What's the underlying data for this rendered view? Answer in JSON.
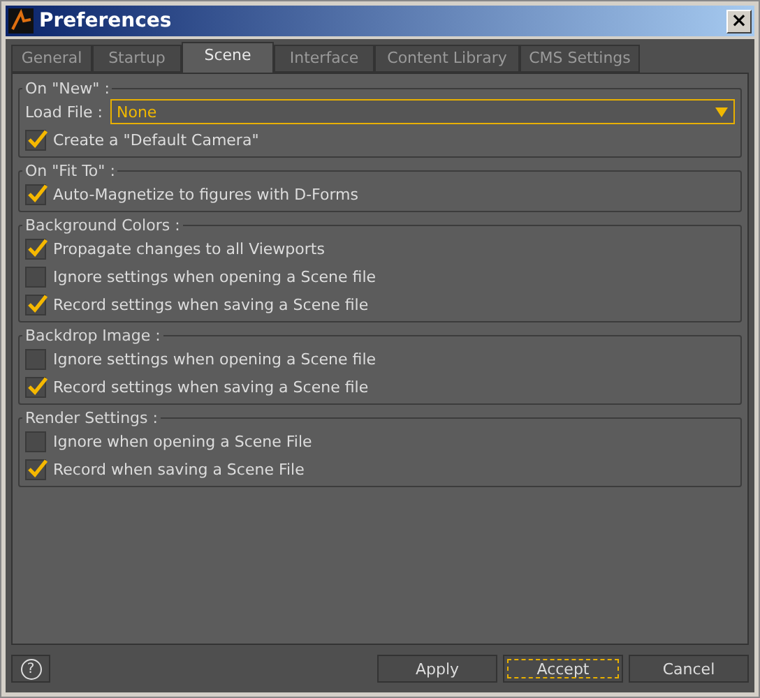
{
  "window": {
    "title": "Preferences",
    "close": "×"
  },
  "tabs": [
    {
      "label": "General",
      "selected": false
    },
    {
      "label": "Startup",
      "selected": false
    },
    {
      "label": "Scene",
      "selected": true
    },
    {
      "label": "Interface",
      "selected": false
    },
    {
      "label": "Content Library",
      "selected": false
    },
    {
      "label": "CMS Settings",
      "selected": false
    }
  ],
  "groups": [
    {
      "title": "On \"New\" :",
      "rows": [
        {
          "kind": "select",
          "label": "Load File :",
          "value": "None"
        },
        {
          "kind": "checkbox",
          "label": "Create a \"Default Camera\"",
          "checked": true
        }
      ]
    },
    {
      "title": "On \"Fit To\" :",
      "rows": [
        {
          "kind": "checkbox",
          "label": "Auto-Magnetize to figures with D-Forms",
          "checked": true
        }
      ]
    },
    {
      "title": "Background Colors :",
      "rows": [
        {
          "kind": "checkbox",
          "label": "Propagate changes to all Viewports",
          "checked": true
        },
        {
          "kind": "checkbox",
          "label": "Ignore settings when opening a Scene file",
          "checked": false
        },
        {
          "kind": "checkbox",
          "label": "Record settings when saving a Scene file",
          "checked": true
        }
      ]
    },
    {
      "title": "Backdrop Image :",
      "rows": [
        {
          "kind": "checkbox",
          "label": "Ignore settings when opening a Scene file",
          "checked": false
        },
        {
          "kind": "checkbox",
          "label": "Record settings when saving a Scene file",
          "checked": true
        }
      ]
    },
    {
      "title": "Render Settings :",
      "rows": [
        {
          "kind": "checkbox",
          "label": "Ignore when opening a Scene File",
          "checked": false
        },
        {
          "kind": "checkbox",
          "label": "Record when saving a Scene File",
          "checked": true
        }
      ]
    }
  ],
  "footer": {
    "help": "?",
    "buttons": [
      {
        "label": "Apply",
        "focused": false
      },
      {
        "label": "Accept",
        "focused": true
      },
      {
        "label": "Cancel",
        "focused": false
      }
    ]
  }
}
